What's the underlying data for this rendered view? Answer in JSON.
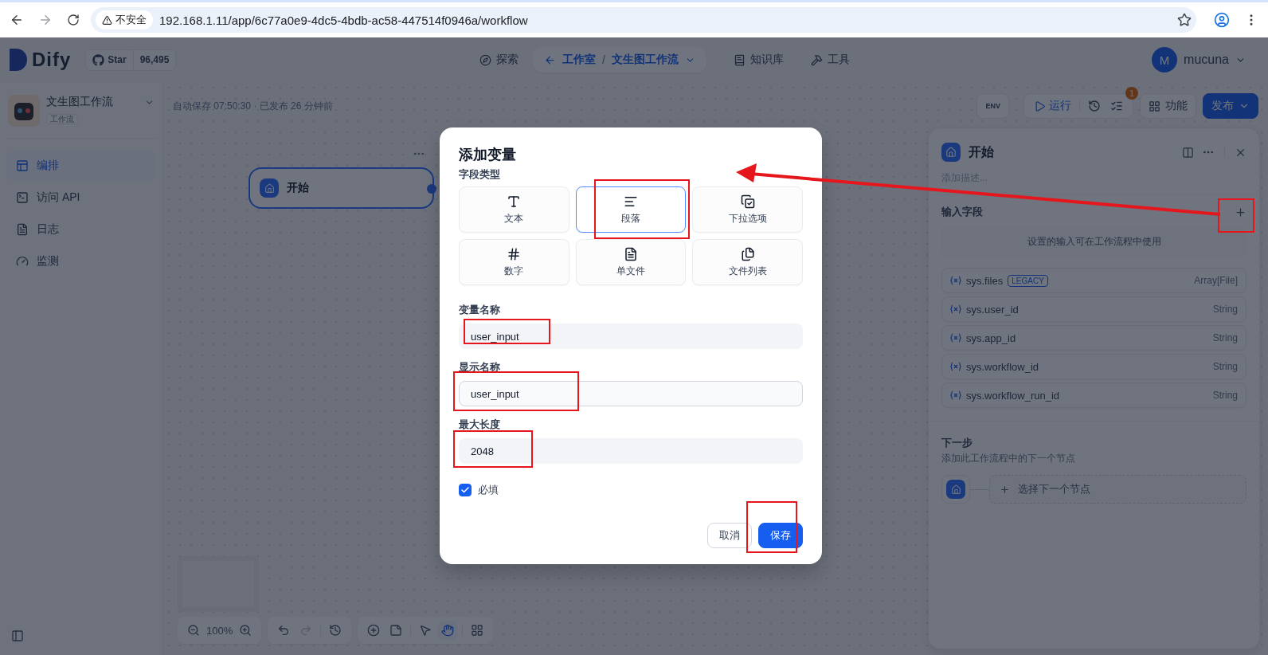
{
  "browser": {
    "security": "不安全",
    "url": "192.168.1.11/app/6c77a0e9-4dc5-4bdb-ac58-447514f0946a/workflow"
  },
  "header": {
    "logo": "Dify",
    "star_label": "Star",
    "star_count": "96,495",
    "explore": "探索",
    "breadcrumb": {
      "back": "工作室",
      "separator": "/",
      "current": "文生图工作流"
    },
    "nav": [
      {
        "label": "知识库"
      },
      {
        "label": "工具"
      }
    ],
    "user": {
      "initial": "M",
      "name": "mucuna"
    }
  },
  "sidebar": {
    "app": {
      "name": "文生图工作流",
      "type": "工作流"
    },
    "items": [
      {
        "label": "编排",
        "selected": true
      },
      {
        "label": "访问 API",
        "selected": false
      },
      {
        "label": "日志",
        "selected": false
      },
      {
        "label": "监测",
        "selected": false
      }
    ]
  },
  "canvas": {
    "autosave": "自动保存 07:50:30 · 已发布 26 分钟前",
    "node": "开始",
    "env": "ENV",
    "run": "运行",
    "badge": "1",
    "features": "功能",
    "publish": "发布",
    "zoom": "100%"
  },
  "panel": {
    "title": "开始",
    "description": "添加描述...",
    "section": "输入字段",
    "hint": "设置的输入可在工作流程中使用",
    "variables": [
      {
        "name": "sys.files",
        "tag": "LEGACY",
        "type": "Array[File]"
      },
      {
        "name": "sys.user_id",
        "type": "String"
      },
      {
        "name": "sys.app_id",
        "type": "String"
      },
      {
        "name": "sys.workflow_id",
        "type": "String"
      },
      {
        "name": "sys.workflow_run_id",
        "type": "String"
      }
    ],
    "next_title": "下一步",
    "next_desc": "添加此工作流程中的下一个节点",
    "next_select": "选择下一个节点"
  },
  "modal": {
    "title": "添加变量",
    "type_label": "字段类型",
    "types": [
      {
        "label": "文本",
        "selected": false
      },
      {
        "label": "段落",
        "selected": true
      },
      {
        "label": "下拉选项",
        "selected": false
      },
      {
        "label": "数字",
        "selected": false
      },
      {
        "label": "单文件",
        "selected": false
      },
      {
        "label": "文件列表",
        "selected": false
      }
    ],
    "fields": [
      {
        "label": "变量名称",
        "value": "user_input",
        "kind": "plain"
      },
      {
        "label": "显示名称",
        "value": "user_input",
        "kind": "bordered"
      },
      {
        "label": "最大长度",
        "value": "2048",
        "kind": "plain"
      }
    ],
    "required": {
      "label": "必填",
      "checked": true
    },
    "cancel": "取消",
    "save": "保存"
  }
}
